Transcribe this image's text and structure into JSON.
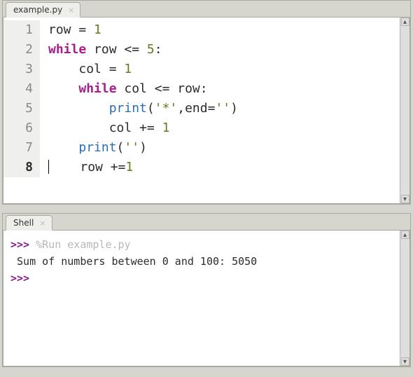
{
  "editor": {
    "tab": {
      "label": "example.py",
      "close_glyph": "×"
    },
    "gutter_start": 1,
    "gutter_count": 8,
    "current_line": 8,
    "code_lines": [
      {
        "indent": 0,
        "tokens": [
          {
            "t": "txt",
            "v": "row = "
          },
          {
            "t": "num",
            "v": "1"
          }
        ]
      },
      {
        "indent": 0,
        "tokens": [
          {
            "t": "kw",
            "v": "while"
          },
          {
            "t": "txt",
            "v": " row <= "
          },
          {
            "t": "num",
            "v": "5"
          },
          {
            "t": "txt",
            "v": ":"
          }
        ]
      },
      {
        "indent": 1,
        "tokens": [
          {
            "t": "txt",
            "v": "col = "
          },
          {
            "t": "num",
            "v": "1"
          }
        ]
      },
      {
        "indent": 1,
        "tokens": [
          {
            "t": "kw",
            "v": "while"
          },
          {
            "t": "txt",
            "v": " col <= row:"
          }
        ]
      },
      {
        "indent": 2,
        "tokens": [
          {
            "t": "fn",
            "v": "print"
          },
          {
            "t": "txt",
            "v": "("
          },
          {
            "t": "str",
            "v": "'*'"
          },
          {
            "t": "txt",
            "v": ",end="
          },
          {
            "t": "str",
            "v": "''"
          },
          {
            "t": "txt",
            "v": ")"
          }
        ]
      },
      {
        "indent": 2,
        "tokens": [
          {
            "t": "txt",
            "v": "col += "
          },
          {
            "t": "num",
            "v": "1"
          }
        ]
      },
      {
        "indent": 1,
        "tokens": [
          {
            "t": "fn",
            "v": "print"
          },
          {
            "t": "txt",
            "v": "("
          },
          {
            "t": "str",
            "v": "''"
          },
          {
            "t": "txt",
            "v": ")"
          }
        ]
      },
      {
        "indent": 1,
        "tokens": [
          {
            "t": "txt",
            "v": "row +="
          },
          {
            "t": "num",
            "v": "1"
          }
        ],
        "caret_before": true
      }
    ]
  },
  "shell": {
    "tab": {
      "label": "Shell",
      "close_glyph": "×"
    },
    "lines": [
      {
        "type": "cmd",
        "prompt": ">>> ",
        "cmd": "%Run example.py"
      },
      {
        "type": "out",
        "text": " Sum of numbers between 0 and 100: 5050"
      },
      {
        "type": "prompt",
        "prompt": ">>> "
      }
    ]
  },
  "scrollbar": {
    "up_glyph": "▴",
    "down_glyph": "▾"
  }
}
